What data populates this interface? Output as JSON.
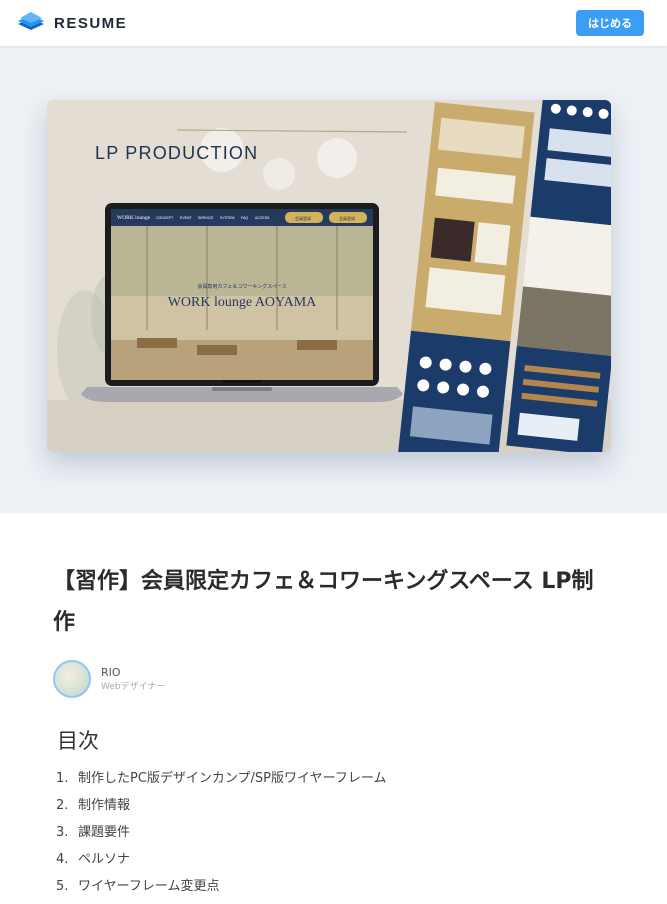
{
  "header": {
    "brand": "RESUME",
    "cta_label": "はじめる"
  },
  "hero": {
    "mockup_heading": "LP PRODUCTION",
    "laptop_logo": "WORK lounge",
    "laptop_logo_sub": "AOYAMA",
    "laptop_nav": [
      "CONCEPT",
      "EVENT",
      "SERVICE",
      "SYSTEM",
      "FAQ",
      "ACCESS"
    ],
    "laptop_btn_1": "会員登録",
    "laptop_btn_2": "会員登録",
    "laptop_tagline": "会員専用カフェ＆コワーキングスペース",
    "laptop_title": "WORK lounge AOYAMA"
  },
  "article": {
    "title": "【習作】会員限定カフェ＆コワーキングスペース LP制作",
    "author_name": "RIO",
    "author_role": "Webデザイナー",
    "toc_heading": "目次",
    "toc": [
      {
        "num": "1.",
        "label": "制作したPC版デザインカンプ/SP版ワイヤーフレーム"
      },
      {
        "num": "2.",
        "label": "制作情報"
      },
      {
        "num": "3.",
        "label": "課題要件"
      },
      {
        "num": "4.",
        "label": "ペルソナ"
      },
      {
        "num": "5.",
        "label": "ワイヤーフレーム変更点"
      }
    ]
  }
}
